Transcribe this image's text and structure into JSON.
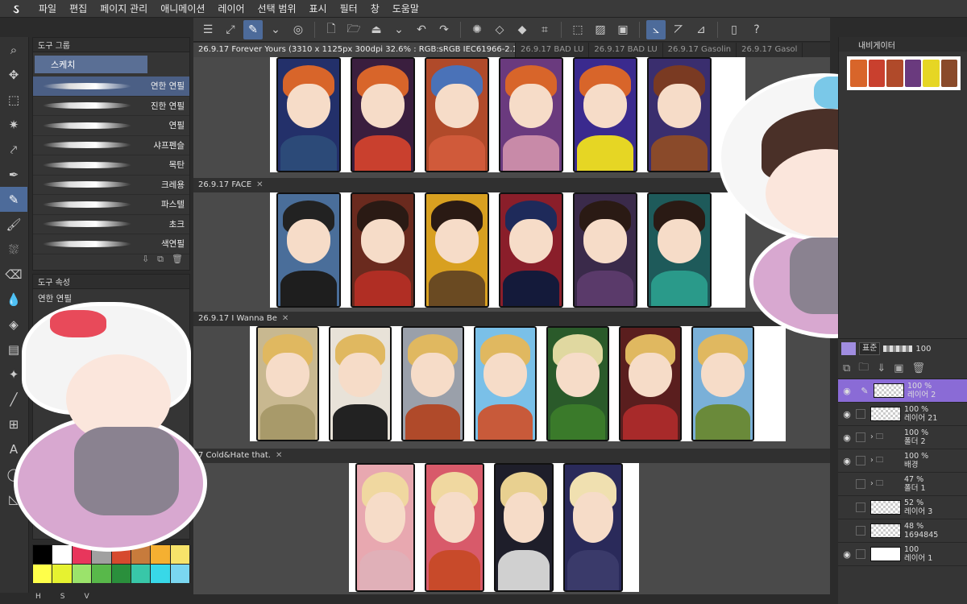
{
  "menu": {
    "items": [
      "파일",
      "편집",
      "페이지 관리",
      "애니메이션",
      "레이어",
      "선택 범위",
      "표시",
      "필터",
      "창",
      "도움말"
    ]
  },
  "subtool_panel": {
    "title": "도구 그룹",
    "tab": "스케치",
    "brushes": [
      "연한 연필",
      "진한 연필",
      "연필",
      "샤프펜슬",
      "목탄",
      "크레용",
      "파스텔",
      "초크",
      "색연필"
    ]
  },
  "tool_property": {
    "title": "도구 속성",
    "current": "연한 연필"
  },
  "palette": {
    "colors": [
      "#000000",
      "#ffffff",
      "#e8365c",
      "#a0a0a0",
      "#d64a2e",
      "#c77b3c",
      "#f5b031",
      "#f7e36a",
      "#ffff4a",
      "#e6f230",
      "#9be36b",
      "#58b84a",
      "#2a8f3c",
      "#38c7a8",
      "#38d8e8",
      "#7ad6f0"
    ]
  },
  "hsv": [
    "H",
    "S",
    "V"
  ],
  "documents": {
    "tabs": [
      "26.9.17 Forever Yours (3310 x 1125px 300dpi 32.6% : RGB:sRGB IEC61966-2.1)",
      "26.9.17 BAD LU",
      "26.9.17 BAD LU",
      "26.9.17 Gasolin",
      "26.9.17 Gasol"
    ],
    "row_tabs": [
      "26.9.17 FACE",
      "26.9.17 I Wanna Be",
      "7 Cold&Hate that."
    ]
  },
  "navigator": {
    "title": "내비게이터"
  },
  "layers": {
    "blend_mode": "표준",
    "opacity": "100",
    "items": [
      {
        "opacity": "100 %",
        "name": "레이어 2",
        "type": "layer",
        "selected": true
      },
      {
        "opacity": "100 %",
        "name": "레이어 21",
        "type": "layer",
        "selected": false
      },
      {
        "opacity": "100 %",
        "name": "폴더 2",
        "type": "folder",
        "selected": false
      },
      {
        "opacity": "100 %",
        "name": "배경",
        "type": "folder",
        "selected": false
      },
      {
        "opacity": "47 %",
        "name": "폴더 1",
        "type": "folder",
        "selected": false
      },
      {
        "opacity": "52 %",
        "name": "레이어 3",
        "type": "layer",
        "selected": false
      },
      {
        "opacity": "48 %",
        "name": "1694845",
        "type": "layer",
        "selected": false
      },
      {
        "opacity": "100",
        "name": "레이어 1",
        "type": "layer",
        "selected": false
      }
    ]
  }
}
